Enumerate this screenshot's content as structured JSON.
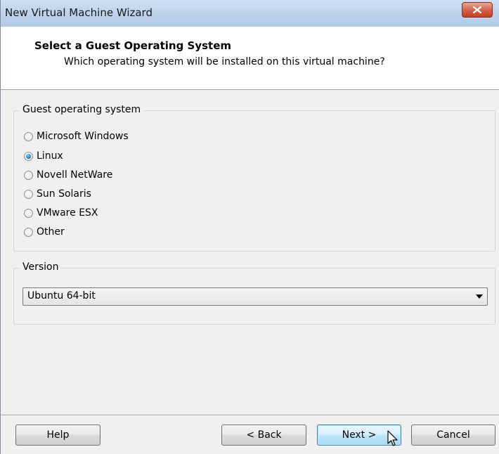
{
  "window": {
    "title": "New Virtual Machine Wizard",
    "close_icon": "close-x-icon"
  },
  "header": {
    "title": "Select a Guest Operating System",
    "subtitle": "Which operating system will be installed on this virtual machine?"
  },
  "guest_os": {
    "group_label": "Guest operating system",
    "options": [
      {
        "label": "Microsoft Windows",
        "selected": false
      },
      {
        "label": "Linux",
        "selected": true
      },
      {
        "label": "Novell NetWare",
        "selected": false
      },
      {
        "label": "Sun Solaris",
        "selected": false
      },
      {
        "label": "VMware ESX",
        "selected": false
      },
      {
        "label": "Other",
        "selected": false
      }
    ]
  },
  "version": {
    "group_label": "Version",
    "selected_value": "Ubuntu 64-bit",
    "dropdown_icon": "chevron-down-icon"
  },
  "buttons": {
    "help": "Help",
    "back": "< Back",
    "next": "Next >",
    "cancel": "Cancel"
  },
  "colors": {
    "titlebar": "#bcd2ea",
    "close_button": "#c2401f",
    "default_button_border": "#3c7fb1",
    "radio_selected": "#1a6fc8"
  }
}
